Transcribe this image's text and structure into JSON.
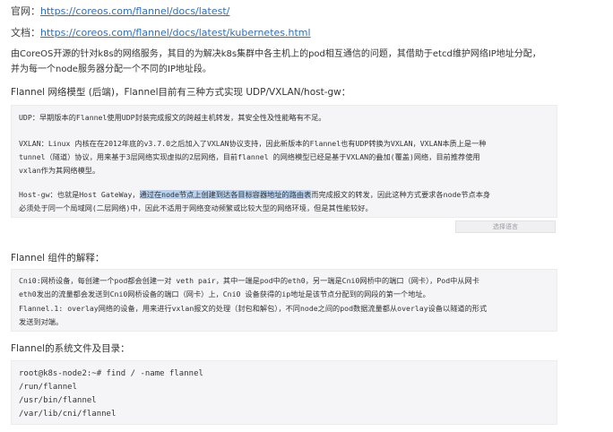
{
  "official": {
    "label": "官网：",
    "url": "https://coreos.com/flannel/docs/latest/"
  },
  "docs": {
    "label": "文档：",
    "url": "https://coreos.com/flannel/docs/latest/kubernetes.html"
  },
  "intro": {
    "line1": "由CoreOS开源的针对k8s的网络服务，其目的为解决k8s集群中各主机上的pod相互通信的问题，其借助于etcd维护网络IP地址分配，",
    "line2": "并为每一个node服务器分配一个不同的IP地址段。"
  },
  "model_heading": "Flannel 网络模型 (后端)，Flannel目前有三种方式实现 UDP/VXLAN/host-gw：",
  "model_block": {
    "udp": "UDP：早期版本的Flannel使用UDP封装完成报文的跨越主机转发，其安全性及性能略有不足。",
    "vxlan1": "VXLAN：Linux 内核在在2012年底的v3.7.0之后加入了VXLAN协议支持，因此新版本的Flannel也有UDP转换为VXLAN，VXLAN本质上是一种",
    "vxlan2": "tunnel（隧道）协议，用来基于3层网络实现虚拟的2层网络，目前flannel 的网络模型已经是基于VXLAN的叠加(覆盖)网络，目前推荐使用",
    "vxlan3": "vxlan作为其网络模型。",
    "hostgw_pre": "Host-gw：也就是Host GateWay，",
    "hostgw_hl": "通过在node节点上创建到达各目标容器地址的路由表",
    "hostgw_post": "而完成报文的转发，因此这种方式要求各node节点本身",
    "hostgw2": "必须处于同一个局域网(二层网络)中，因此不适用于网络变动频繁或比较大型的网络环境，但是其性能较好。"
  },
  "lang_button": "选择语言",
  "component_heading": "Flannel 组件的解释：",
  "component_block": {
    "l1": "Cni0:网桥设备，每创建一个pod都会创建一对 veth pair，其中一端是pod中的eth0，另一端是Cni0网桥中的端口（网卡），Pod中从网卡",
    "l2": "eth0发出的流量都会发送到Cni0网桥设备的端口（网卡）上，Cni0 设备获得的ip地址是该节点分配到的网段的第一个地址。",
    "l3": "Flannel.1: overlay网络的设备，用来进行vxlan报文的处理（封包和解包），不同node之间的pod数据流量都从overlay设备以隧道的形式",
    "l4": "发送到对端。"
  },
  "files_heading": "Flannel的系统文件及目录：",
  "files_block": {
    "l1": "root@k8s-node2:~#  find / -name flannel",
    "l2": "/run/flannel",
    "l3": "/usr/bin/flannel",
    "l4": "/var/lib/cni/flannel"
  }
}
